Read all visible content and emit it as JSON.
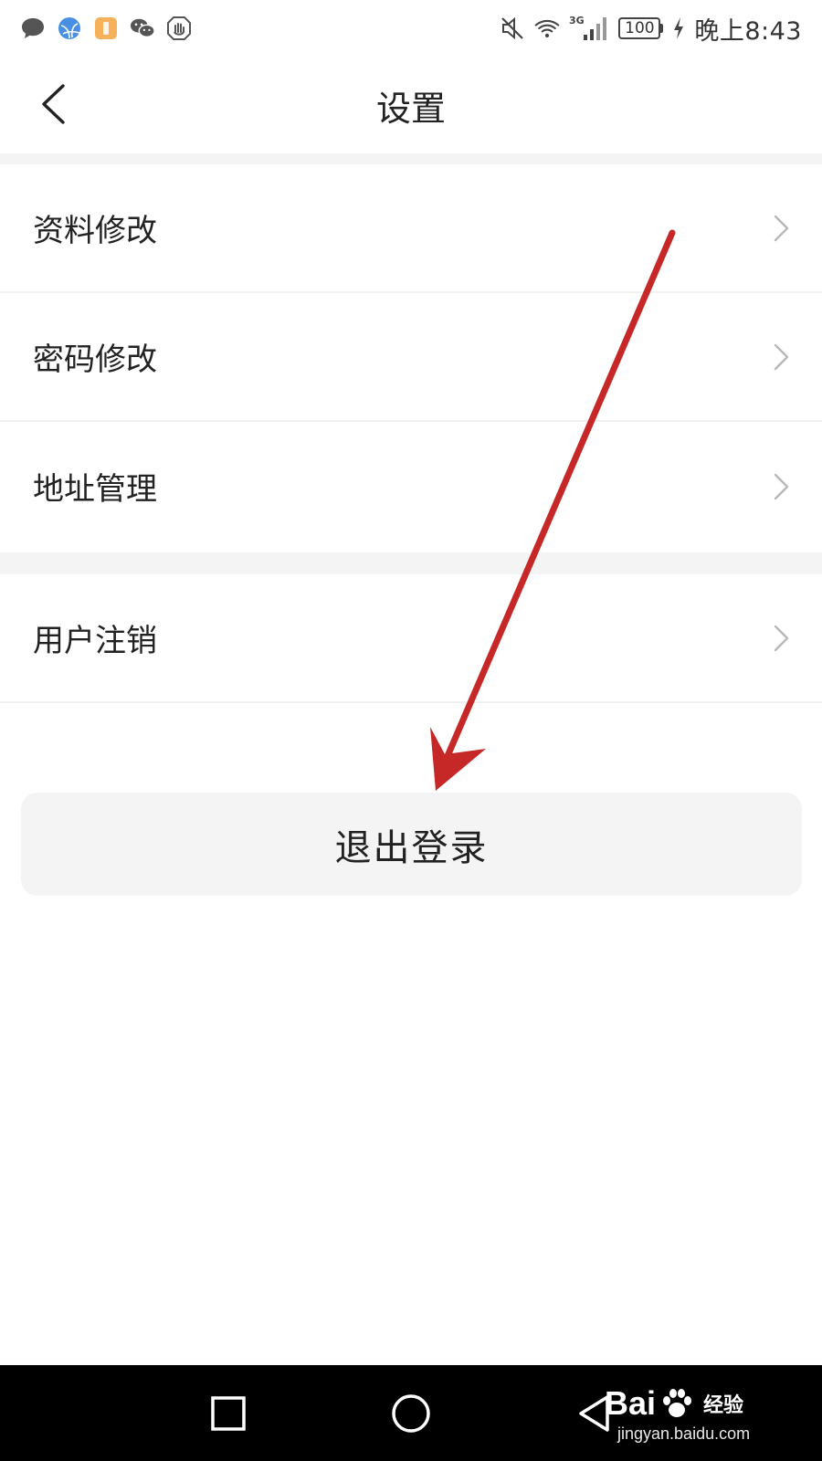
{
  "status_bar": {
    "clock": "晚上8:43",
    "battery": "100",
    "network": "3G",
    "notification_icons": [
      "message-icon",
      "browser-icon",
      "app-icon",
      "wechat-icon",
      "security-icon"
    ],
    "system_icons": [
      "mute-icon",
      "wifi-icon",
      "signal-icon",
      "battery-icon",
      "charging-icon"
    ]
  },
  "header": {
    "title": "设置"
  },
  "settings": {
    "group1": [
      {
        "label": "资料修改"
      },
      {
        "label": "密码修改"
      },
      {
        "label": "地址管理"
      }
    ],
    "group2": [
      {
        "label": "用户注销"
      }
    ]
  },
  "logout": {
    "label": "退出登录"
  },
  "annotation": {
    "color": "#c62828",
    "type": "arrow"
  },
  "watermark": {
    "brand": "Bai",
    "brand_suffix": "经验",
    "url": "jingyan.baidu.com"
  },
  "colors": {
    "background": "#ffffff",
    "band": "#f4f4f4",
    "text": "#222222",
    "nav_bar": "#000000"
  }
}
